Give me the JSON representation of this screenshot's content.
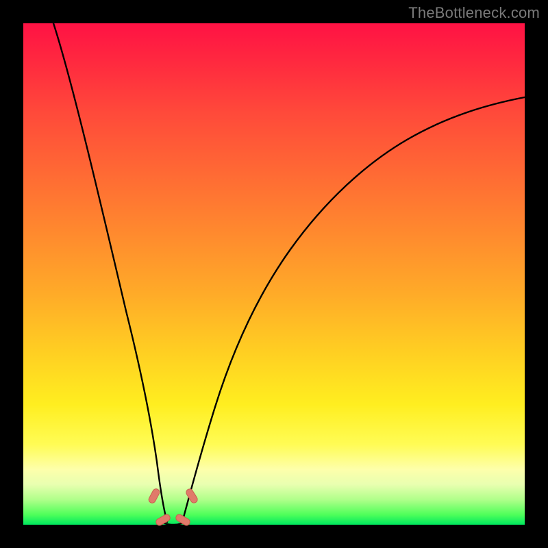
{
  "watermark": "TheBottleneck.com",
  "gradient_colors": {
    "top": "#ff1244",
    "mid_high": "#ff8a2e",
    "mid": "#ffee20",
    "mid_low": "#fdffab",
    "bottom": "#00e85e"
  },
  "chart_data": {
    "type": "line",
    "title": "",
    "xlabel": "",
    "ylabel": "",
    "xlim": [
      0,
      100
    ],
    "ylim": [
      0,
      100
    ],
    "grid": false,
    "series": [
      {
        "name": "left-branch",
        "x": [
          6,
          8,
          10,
          12,
          14,
          16,
          18,
          20,
          22,
          24,
          25.5,
          27
        ],
        "values": [
          100,
          88,
          76,
          65,
          54,
          44,
          34,
          24,
          15,
          8,
          3,
          0
        ]
      },
      {
        "name": "right-branch",
        "x": [
          30,
          32,
          34,
          37,
          40,
          44,
          48,
          53,
          58,
          64,
          70,
          77,
          85,
          93,
          100
        ],
        "values": [
          0,
          5,
          12,
          21,
          30,
          39,
          47,
          54,
          60,
          66,
          71,
          75,
          78.5,
          81.5,
          84
        ]
      },
      {
        "name": "valley-flat",
        "x": [
          27,
          28.5,
          30
        ],
        "values": [
          0,
          0,
          0
        ]
      }
    ],
    "markers": [
      {
        "name": "left-marker-low",
        "x": 25.0,
        "y": 7,
        "angle": -62
      },
      {
        "name": "left-marker-high",
        "x": 26.8,
        "y": 1,
        "angle": -30
      },
      {
        "name": "right-marker-low",
        "x": 31.0,
        "y": 1,
        "angle": 30
      },
      {
        "name": "right-marker-high",
        "x": 32.5,
        "y": 7,
        "angle": 58
      }
    ]
  }
}
